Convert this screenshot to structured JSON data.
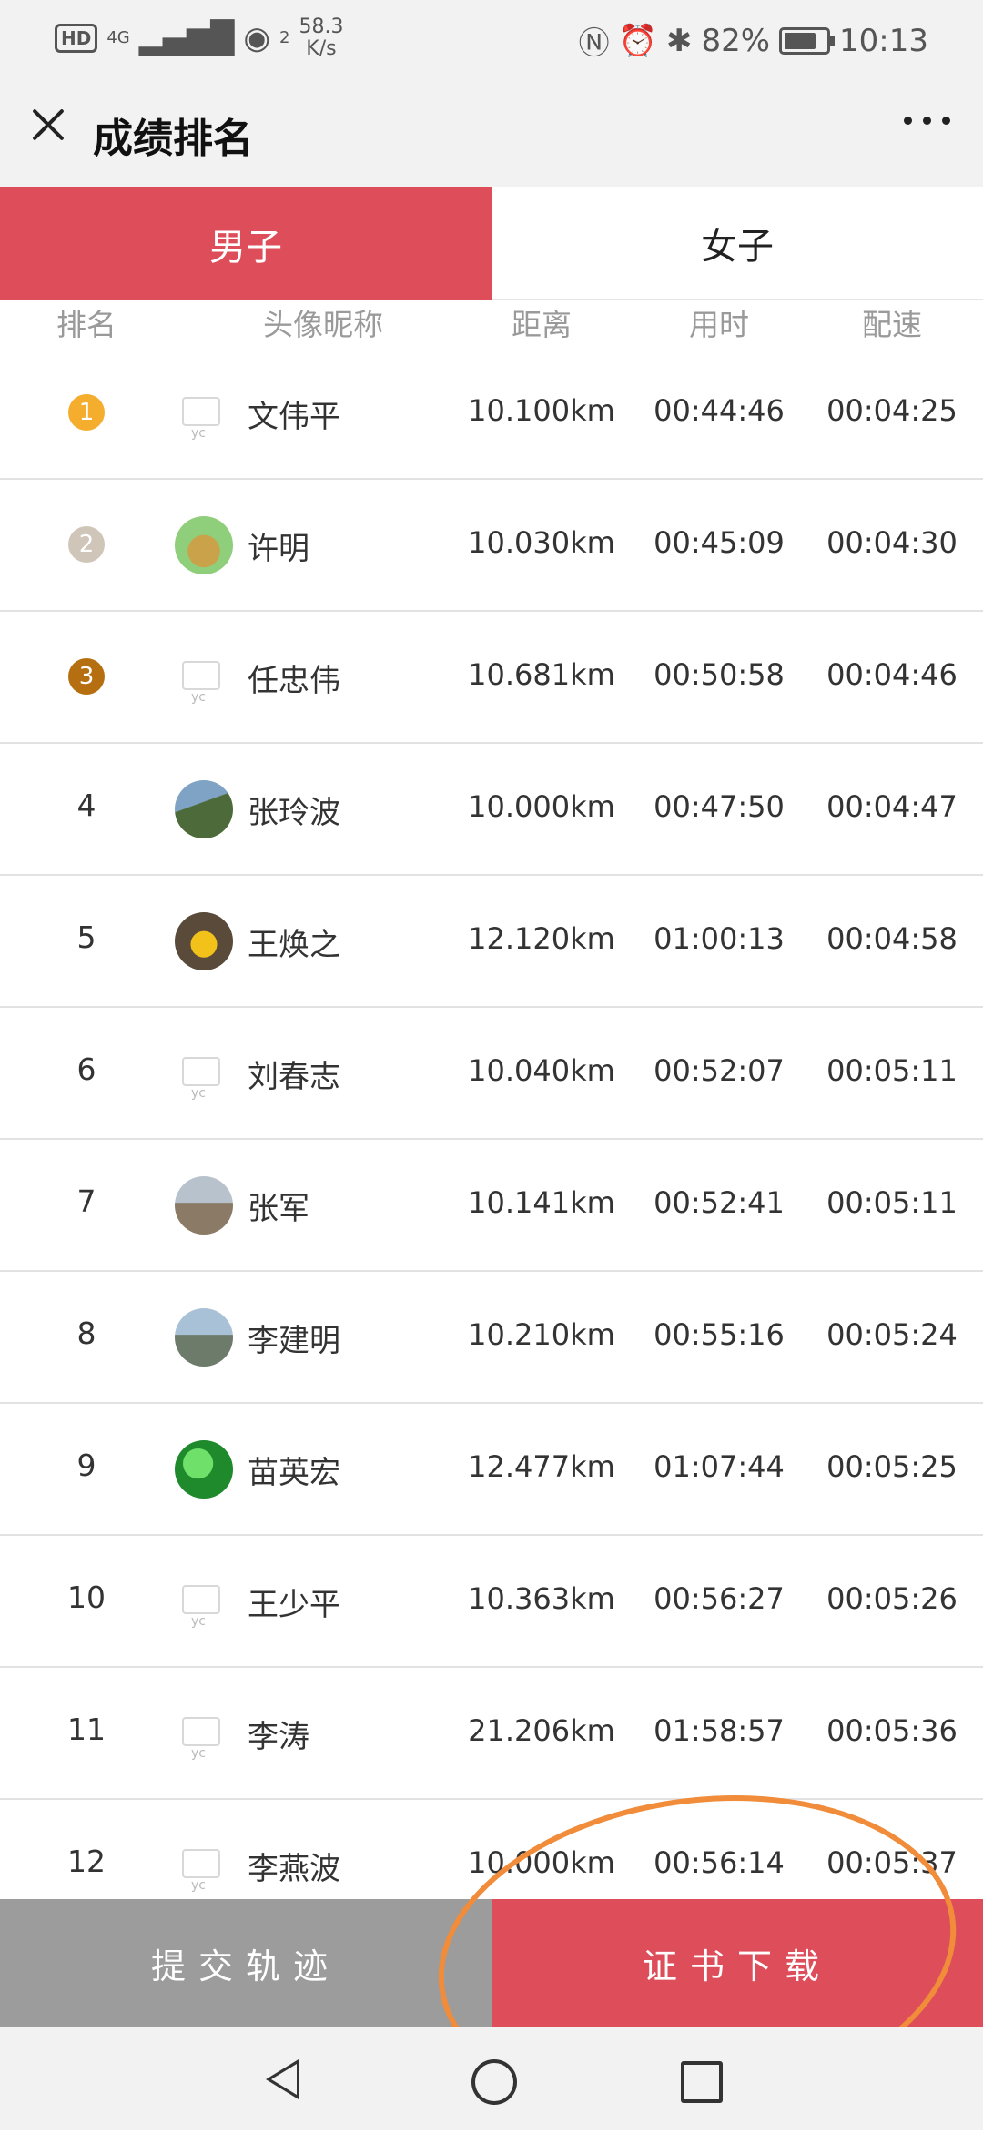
{
  "status_bar": {
    "hd": "HD",
    "network": "4G",
    "hotspot": "2",
    "speed_value": "58.3",
    "speed_unit": "K/s",
    "battery": "82%",
    "time": "10:13"
  },
  "header": {
    "title": "成绩排名"
  },
  "tabs": [
    {
      "label": "男子",
      "active": true
    },
    {
      "label": "女子",
      "active": false
    }
  ],
  "columns": {
    "rank": "排名",
    "name": "头像昵称",
    "distance": "距离",
    "time": "用时",
    "pace": "配速"
  },
  "rows": [
    {
      "rank": "1",
      "name": "文伟平",
      "distance": "10.100km",
      "time": "00:44:46",
      "pace": "00:04:25"
    },
    {
      "rank": "2",
      "name": "许明",
      "distance": "10.030km",
      "time": "00:45:09",
      "pace": "00:04:30"
    },
    {
      "rank": "3",
      "name": "任忠伟",
      "distance": "10.681km",
      "time": "00:50:58",
      "pace": "00:04:46"
    },
    {
      "rank": "4",
      "name": "张玲波",
      "distance": "10.000km",
      "time": "00:47:50",
      "pace": "00:04:47"
    },
    {
      "rank": "5",
      "name": "王焕之",
      "distance": "12.120km",
      "time": "01:00:13",
      "pace": "00:04:58"
    },
    {
      "rank": "6",
      "name": "刘春志",
      "distance": "10.040km",
      "time": "00:52:07",
      "pace": "00:05:11"
    },
    {
      "rank": "7",
      "name": "张军",
      "distance": "10.141km",
      "time": "00:52:41",
      "pace": "00:05:11"
    },
    {
      "rank": "8",
      "name": "李建明",
      "distance": "10.210km",
      "time": "00:55:16",
      "pace": "00:05:24"
    },
    {
      "rank": "9",
      "name": "苗英宏",
      "distance": "12.477km",
      "time": "01:07:44",
      "pace": "00:05:25"
    },
    {
      "rank": "10",
      "name": "王少平",
      "distance": "10.363km",
      "time": "00:56:27",
      "pace": "00:05:26"
    },
    {
      "rank": "11",
      "name": "李涛",
      "distance": "21.206km",
      "time": "01:58:57",
      "pace": "00:05:36"
    },
    {
      "rank": "12",
      "name": "李燕波",
      "distance": "10.000km",
      "time": "00:56:14",
      "pace": "00:05:37"
    }
  ],
  "buttons": {
    "submit": "提交轨迹",
    "certificate": "证书下载"
  },
  "colors": {
    "accent": "#dd4e5a",
    "gold": "#f4ad2c",
    "silver": "#cfc5b8",
    "bronze": "#b56f10",
    "annotation": "#f08c3a"
  }
}
